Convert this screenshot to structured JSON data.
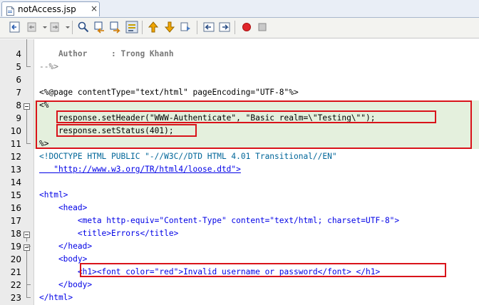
{
  "tab": {
    "title": "notAccess.jsp",
    "close": "×"
  },
  "toolbar": {
    "buttons": [
      "back-to-last-edit",
      "back",
      "forward",
      "find-selection",
      "find-previous",
      "find-next",
      "toggle-highlight",
      "previous-bookmark",
      "next-bookmark",
      "toggle-bookmark",
      "shift-left",
      "shift-right",
      "start-macro",
      "stop-macro"
    ]
  },
  "editor": {
    "lines": [
      {
        "n": "4",
        "text": "    Author     : Trong Khanh"
      },
      {
        "n": "5",
        "text": "--%>"
      },
      {
        "n": "7",
        "text": "<%@page contentType=\"text/html\" pageEncoding=\"UTF-8\"%>"
      },
      {
        "n": "8",
        "text": "<%"
      },
      {
        "n": "9",
        "text": "    response.setHeader(\"WWW-Authenticate\", \"Basic realm=\\\"Testing\\\"\");"
      },
      {
        "n": "10",
        "text": "    response.setStatus(401);"
      },
      {
        "n": "11",
        "text": "%>"
      },
      {
        "n": "12",
        "text": "<!DOCTYPE HTML PUBLIC \"-//W3C//DTD HTML 4.01 Transitional//EN\""
      },
      {
        "n": "13",
        "text": "   \"http://www.w3.org/TR/html4/loose.dtd\">"
      },
      {
        "n": "14",
        "text": ""
      },
      {
        "n": "15",
        "text": "<html>"
      },
      {
        "n": "16",
        "text": "    <head>"
      },
      {
        "n": "17",
        "text": "        <meta http-equiv=\"Content-Type\" content=\"text/html; charset=UTF-8\">"
      },
      {
        "n": "18",
        "text": "        <title>Errors</title>"
      },
      {
        "n": "19",
        "text": "    </head>"
      },
      {
        "n": "20",
        "text": "    <body>"
      },
      {
        "n": "21",
        "text": "        <h1><font color=\"red\">Invalid username or password</font> </h1>"
      },
      {
        "n": "22",
        "text": "    </body>"
      },
      {
        "n": "23",
        "text": "</html>"
      }
    ],
    "highlight_color": "#d9131a"
  }
}
